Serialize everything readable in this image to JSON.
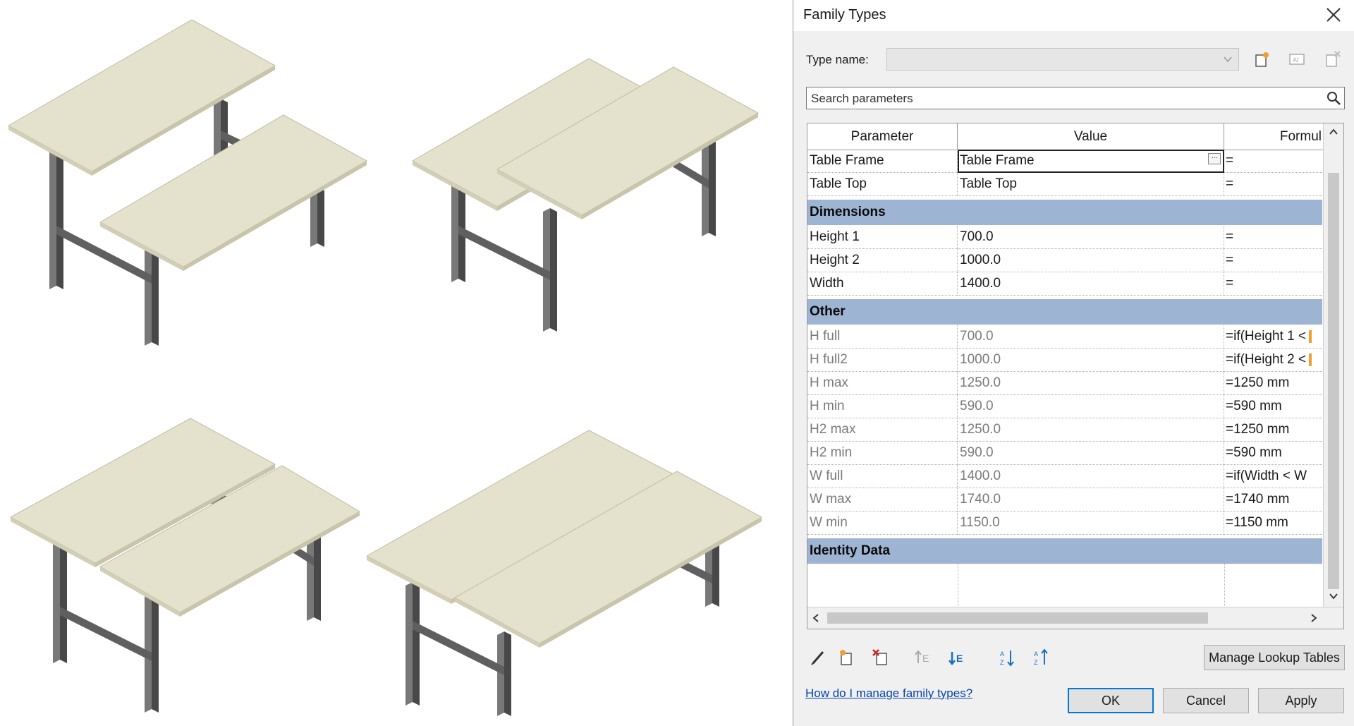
{
  "dialog": {
    "title": "Family Types",
    "type_name_label": "Type name:",
    "type_name_value": "",
    "search_placeholder": "Search parameters",
    "columns": {
      "parameter": "Parameter",
      "value": "Value",
      "formula": "Formul"
    },
    "rows_top": [
      {
        "parameter": "Table Frame",
        "value": "Table Frame",
        "formula": "="
      },
      {
        "parameter": "Table Top",
        "value": "Table Top",
        "formula": "="
      }
    ],
    "group_dimensions": "Dimensions",
    "rows_dimensions": [
      {
        "parameter": "Height 1",
        "value": "700.0",
        "formula": "="
      },
      {
        "parameter": "Height 2",
        "value": "1000.0",
        "formula": "="
      },
      {
        "parameter": "Width",
        "value": "1400.0",
        "formula": "="
      }
    ],
    "group_other": "Other",
    "rows_other": [
      {
        "parameter": "H full",
        "value": "700.0",
        "formula": "=if(Height 1 <"
      },
      {
        "parameter": "H full2",
        "value": "1000.0",
        "formula": "=if(Height 2 <"
      },
      {
        "parameter": "H max",
        "value": "1250.0",
        "formula": "=1250 mm"
      },
      {
        "parameter": "H min",
        "value": "590.0",
        "formula": "=590 mm"
      },
      {
        "parameter": "H2 max",
        "value": "1250.0",
        "formula": "=1250 mm"
      },
      {
        "parameter": "H2 min",
        "value": "590.0",
        "formula": "=590 mm"
      },
      {
        "parameter": "W full",
        "value": "1400.0",
        "formula": "=if(Width < W"
      },
      {
        "parameter": "W max",
        "value": "1740.0",
        "formula": "=1740 mm"
      },
      {
        "parameter": "W min",
        "value": "1150.0",
        "formula": "=1150 mm"
      }
    ],
    "group_identity": "Identity Data",
    "manage_lookup_label": "Manage Lookup Tables",
    "help_link": "How do I manage family types?",
    "ok_label": "OK",
    "cancel_label": "Cancel",
    "apply_label": "Apply",
    "accent_color": "#0078d7",
    "group_color": "#9db4d2"
  },
  "viewport": {
    "tabletop_color": "#e4e2cc",
    "leg_color": "#5f5f5f"
  }
}
